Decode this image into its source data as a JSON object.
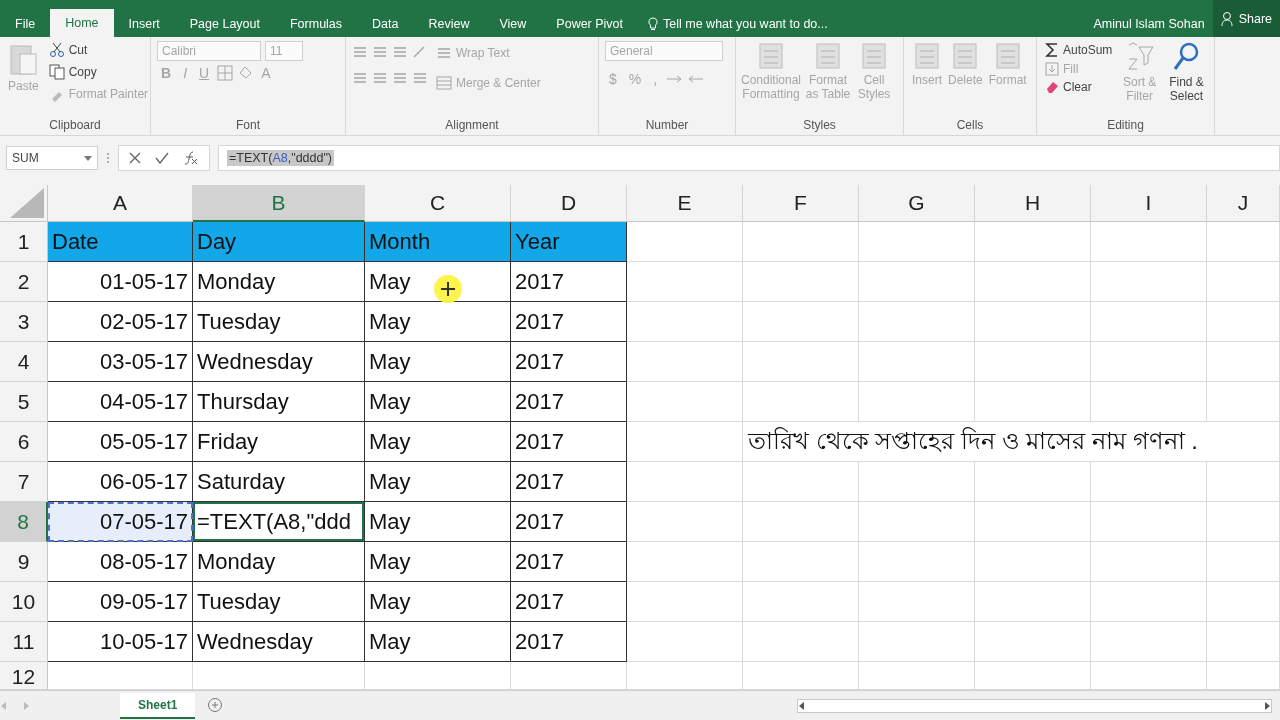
{
  "title_bar": {
    "user": "Aminul Islam Sohan",
    "share": "Share",
    "tell_me": "Tell me what you want to do..."
  },
  "tabs": [
    {
      "label": "File",
      "selected": false
    },
    {
      "label": "Home",
      "selected": true
    },
    {
      "label": "Insert",
      "selected": false
    },
    {
      "label": "Page Layout",
      "selected": false
    },
    {
      "label": "Formulas",
      "selected": false
    },
    {
      "label": "Data",
      "selected": false
    },
    {
      "label": "Review",
      "selected": false
    },
    {
      "label": "View",
      "selected": false
    },
    {
      "label": "Power Pivot",
      "selected": false
    }
  ],
  "ribbon": {
    "clipboard": {
      "label": "Clipboard",
      "paste": {
        "label": "Paste",
        "disabled": true
      },
      "cut": {
        "label": "Cut",
        "disabled": false
      },
      "copy": {
        "label": "Copy",
        "disabled": false
      },
      "format_painter": {
        "label": "Format Painter",
        "disabled": true
      }
    },
    "font": {
      "label": "Font",
      "font_name": "Calibri",
      "font_size": "11",
      "bold": "B",
      "italic": "I",
      "underline": "U",
      "font_color": "A"
    },
    "alignment": {
      "label": "Alignment",
      "wrap_text": "Wrap Text",
      "merge_center": "Merge & Center"
    },
    "number": {
      "label": "Number",
      "format": "General",
      "currency": "$",
      "percent": "%",
      "comma": ","
    },
    "styles": {
      "label": "Styles",
      "conditional_formatting": "Conditional Formatting",
      "format_as_table": "Format as Table",
      "cell_styles": "Cell Styles"
    },
    "cells": {
      "label": "Cells",
      "insert": "Insert",
      "delete": "Delete",
      "format": "Format"
    },
    "editing": {
      "label": "Editing",
      "autosum": {
        "label": "AutoSum",
        "disabled": false
      },
      "fill": {
        "label": "Fill",
        "disabled": true
      },
      "clear": {
        "label": "Clear",
        "disabled": false
      },
      "sort_filter": {
        "label": "Sort & Filter",
        "disabled": true
      },
      "find_select": {
        "label": "Find & Select",
        "disabled": false
      }
    }
  },
  "formula_bar": {
    "name_box": "SUM",
    "prefix": "=TEXT(",
    "reference": "A8",
    "suffix": ",\"dddd\")"
  },
  "columns": [
    {
      "label": "A",
      "selected": false
    },
    {
      "label": "B",
      "selected": true
    },
    {
      "label": "C",
      "selected": false
    },
    {
      "label": "D",
      "selected": false
    },
    {
      "label": "E",
      "selected": false
    },
    {
      "label": "F",
      "selected": false
    },
    {
      "label": "G",
      "selected": false
    },
    {
      "label": "H",
      "selected": false
    },
    {
      "label": "I",
      "selected": false
    },
    {
      "label": "J",
      "selected": false
    }
  ],
  "rows": [
    {
      "number": "1",
      "kind": "header",
      "selected": false,
      "cells": [
        {
          "text": "Date",
          "selected": false,
          "referenced": false
        },
        {
          "text": "Day",
          "selected": false,
          "referenced": false
        },
        {
          "text": "Month",
          "selected": false,
          "referenced": false
        },
        {
          "text": "Year",
          "selected": false,
          "referenced": false
        }
      ]
    },
    {
      "number": "2",
      "kind": "data",
      "selected": false,
      "cells": [
        {
          "text": "01-05-17",
          "selected": false,
          "referenced": false
        },
        {
          "text": "Monday",
          "selected": false,
          "referenced": false
        },
        {
          "text": "May",
          "selected": false,
          "referenced": false
        },
        {
          "text": "2017",
          "selected": false,
          "referenced": false
        }
      ]
    },
    {
      "number": "3",
      "kind": "data",
      "selected": false,
      "cells": [
        {
          "text": "02-05-17",
          "selected": false,
          "referenced": false
        },
        {
          "text": "Tuesday",
          "selected": false,
          "referenced": false
        },
        {
          "text": "May",
          "selected": false,
          "referenced": false
        },
        {
          "text": "2017",
          "selected": false,
          "referenced": false
        }
      ]
    },
    {
      "number": "4",
      "kind": "data",
      "selected": false,
      "cells": [
        {
          "text": "03-05-17",
          "selected": false,
          "referenced": false
        },
        {
          "text": "Wednesday",
          "selected": false,
          "referenced": false
        },
        {
          "text": "May",
          "selected": false,
          "referenced": false
        },
        {
          "text": "2017",
          "selected": false,
          "referenced": false
        }
      ]
    },
    {
      "number": "5",
      "kind": "data",
      "selected": false,
      "cells": [
        {
          "text": "04-05-17",
          "selected": false,
          "referenced": false
        },
        {
          "text": "Thursday",
          "selected": false,
          "referenced": false
        },
        {
          "text": "May",
          "selected": false,
          "referenced": false
        },
        {
          "text": "2017",
          "selected": false,
          "referenced": false
        }
      ]
    },
    {
      "number": "6",
      "kind": "data",
      "selected": false,
      "cells": [
        {
          "text": "05-05-17",
          "selected": false,
          "referenced": false
        },
        {
          "text": "Friday",
          "selected": false,
          "referenced": false
        },
        {
          "text": "May",
          "selected": false,
          "referenced": false
        },
        {
          "text": "2017",
          "selected": false,
          "referenced": false
        }
      ],
      "note": "তারিখ থেকে সপ্তাহের দিন ও মাসের নাম গণনা ."
    },
    {
      "number": "7",
      "kind": "data",
      "selected": false,
      "cells": [
        {
          "text": "06-05-17",
          "selected": false,
          "referenced": false
        },
        {
          "text": "Saturday",
          "selected": false,
          "referenced": false
        },
        {
          "text": "May",
          "selected": false,
          "referenced": false
        },
        {
          "text": "2017",
          "selected": false,
          "referenced": false
        }
      ]
    },
    {
      "number": "8",
      "kind": "data",
      "selected": true,
      "cells": [
        {
          "text": "07-05-17",
          "selected": false,
          "referenced": true
        },
        {
          "text": "=TEXT(A8,\"ddd",
          "selected": true,
          "referenced": false
        },
        {
          "text": "May",
          "selected": false,
          "referenced": false
        },
        {
          "text": "2017",
          "selected": false,
          "referenced": false
        }
      ]
    },
    {
      "number": "9",
      "kind": "data",
      "selected": false,
      "cells": [
        {
          "text": "08-05-17",
          "selected": false,
          "referenced": false
        },
        {
          "text": "Monday",
          "selected": false,
          "referenced": false
        },
        {
          "text": "May",
          "selected": false,
          "referenced": false
        },
        {
          "text": "2017",
          "selected": false,
          "referenced": false
        }
      ]
    },
    {
      "number": "10",
      "kind": "data",
      "selected": false,
      "cells": [
        {
          "text": "09-05-17",
          "selected": false,
          "referenced": false
        },
        {
          "text": "Tuesday",
          "selected": false,
          "referenced": false
        },
        {
          "text": "May",
          "selected": false,
          "referenced": false
        },
        {
          "text": "2017",
          "selected": false,
          "referenced": false
        }
      ]
    },
    {
      "number": "11",
      "kind": "data",
      "selected": false,
      "cells": [
        {
          "text": "10-05-17",
          "selected": false,
          "referenced": false
        },
        {
          "text": "Wednesday",
          "selected": false,
          "referenced": false
        },
        {
          "text": "May",
          "selected": false,
          "referenced": false
        },
        {
          "text": "2017",
          "selected": false,
          "referenced": false
        }
      ]
    },
    {
      "number": "12",
      "kind": "empty",
      "selected": false
    }
  ],
  "sheet_tabs": [
    {
      "label": "Sheet1",
      "selected": true
    }
  ]
}
